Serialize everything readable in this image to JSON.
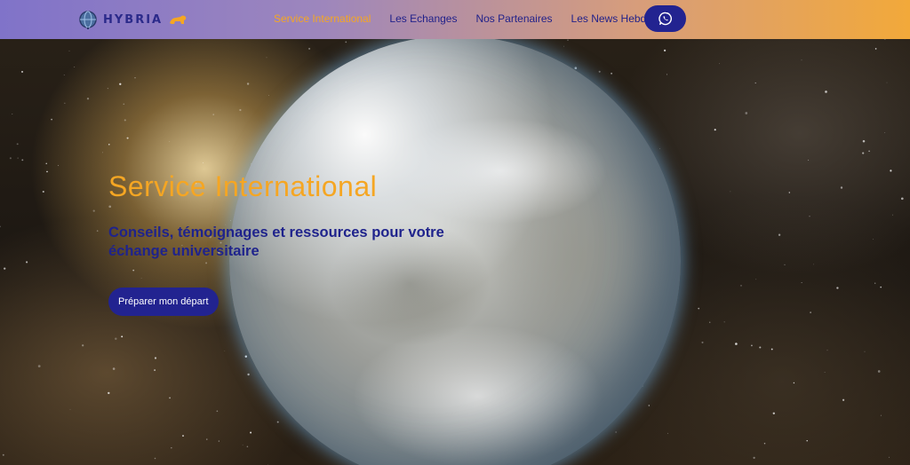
{
  "brand": {
    "name": "HYBRIA",
    "logo_icon": "globe-icon",
    "mascot_icon": "lion-icon"
  },
  "nav": {
    "items": [
      {
        "label": "Service International",
        "active": true
      },
      {
        "label": "Les Echanges",
        "active": false
      },
      {
        "label": "Nos Partenaires",
        "active": false
      },
      {
        "label": "Les News Hebdo",
        "active": false
      }
    ],
    "whatsapp_icon": "whatsapp-icon"
  },
  "hero": {
    "title": "Service International",
    "subtitle": "Conseils, témoignages et ressources pour votre échange universitaire",
    "cta_label": "Préparer mon départ"
  },
  "colors": {
    "accent": "#f5a623",
    "primary": "#222390",
    "nav_gradient_start": "#8073c9",
    "nav_gradient_end": "#f2a93a"
  }
}
